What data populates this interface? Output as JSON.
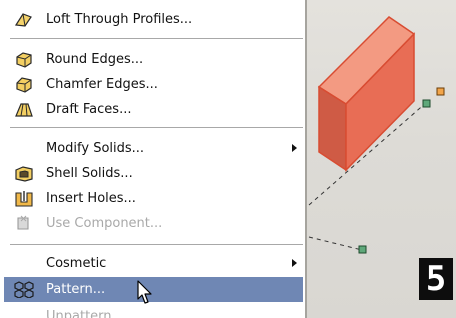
{
  "menu": {
    "items": [
      {
        "label": "Loft Through Profiles...",
        "icon": "loft-icon"
      },
      {
        "label": "Round Edges...",
        "icon": "round-edges-icon"
      },
      {
        "label": "Chamfer Edges...",
        "icon": "chamfer-edges-icon"
      },
      {
        "label": "Draft Faces...",
        "icon": "draft-faces-icon"
      },
      {
        "label": "Modify Solids...",
        "submenu": true
      },
      {
        "label": "Shell Solids...",
        "icon": "shell-solids-icon"
      },
      {
        "label": "Insert Holes...",
        "icon": "insert-holes-icon"
      },
      {
        "label": "Use Component...",
        "icon": "use-component-icon",
        "disabled": true
      },
      {
        "label": "Cosmetic",
        "submenu": true
      },
      {
        "label": "Pattern...",
        "icon": "pattern-icon",
        "highlighted": true
      },
      {
        "label": "Unpattern...",
        "disabled": true
      }
    ]
  },
  "step_badge": "5",
  "colors": {
    "highlight": "#6f87b4",
    "solid_block": "#e86d55",
    "viewport_bg": "#dddbd6",
    "handle_green": "#5fa87a",
    "handle_orange": "#f2a54a"
  }
}
